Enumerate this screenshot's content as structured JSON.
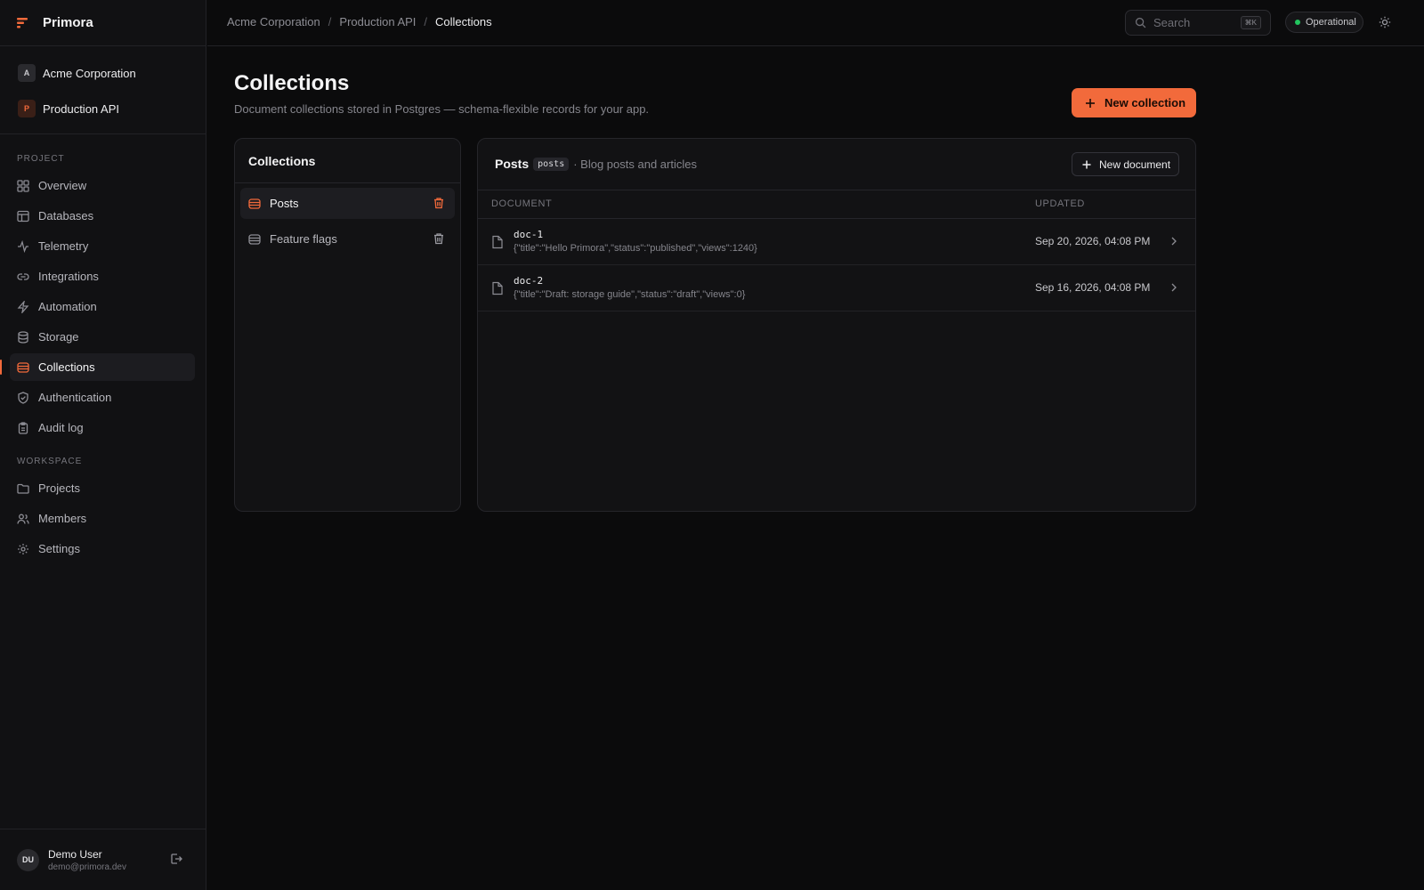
{
  "app": {
    "name": "Primora",
    "accent": "#f26a3b"
  },
  "context": {
    "org": {
      "badge": "A",
      "label": "Acme Corporation"
    },
    "project": {
      "badge": "P",
      "label": "Production API"
    }
  },
  "sidebar": {
    "project_title": "PROJECT",
    "project_items": [
      {
        "label": "Overview",
        "icon": "grid-icon"
      },
      {
        "label": "Databases",
        "icon": "table-icon"
      },
      {
        "label": "Telemetry",
        "icon": "activity-icon"
      },
      {
        "label": "Integrations",
        "icon": "link-icon"
      },
      {
        "label": "Automation",
        "icon": "bolt-icon"
      },
      {
        "label": "Storage",
        "icon": "database-icon"
      },
      {
        "label": "Collections",
        "icon": "collection-icon",
        "active": true
      },
      {
        "label": "Authentication",
        "icon": "shield-icon"
      },
      {
        "label": "Audit log",
        "icon": "clipboard-icon"
      }
    ],
    "workspace_title": "WORKSPACE",
    "workspace_items": [
      {
        "label": "Projects",
        "icon": "folder-icon"
      },
      {
        "label": "Members",
        "icon": "users-icon"
      },
      {
        "label": "Settings",
        "icon": "gear-icon"
      }
    ]
  },
  "user": {
    "initials": "DU",
    "name": "Demo User",
    "email": "demo@primora.dev"
  },
  "topbar": {
    "breadcrumbs": [
      "Acme Corporation",
      "Production API",
      "Collections"
    ],
    "search_placeholder": "Search",
    "search_shortcut": "⌘K",
    "status": "Operational",
    "status_color": "#22c55e"
  },
  "page": {
    "title": "Collections",
    "subtitle": "Document collections stored in Postgres — schema-flexible records for your app.",
    "new_collection_label": "New collection"
  },
  "collections_panel": {
    "title": "Collections",
    "items": [
      {
        "label": "Posts",
        "active": true
      },
      {
        "label": "Feature flags",
        "active": false
      }
    ]
  },
  "documents_panel": {
    "name": "Posts",
    "slug": "posts",
    "description": "· Blog posts and articles",
    "new_document_label": "New document",
    "columns": [
      "DOCUMENT",
      "UPDATED"
    ],
    "rows": [
      {
        "id": "doc-1",
        "json": "{\"title\":\"Hello Primora\",\"status\":\"published\",\"views\":1240}",
        "updated": "Sep 20, 2026, 04:08 PM"
      },
      {
        "id": "doc-2",
        "json": "{\"title\":\"Draft: storage guide\",\"status\":\"draft\",\"views\":0}",
        "updated": "Sep 16, 2026, 04:08 PM"
      }
    ]
  }
}
